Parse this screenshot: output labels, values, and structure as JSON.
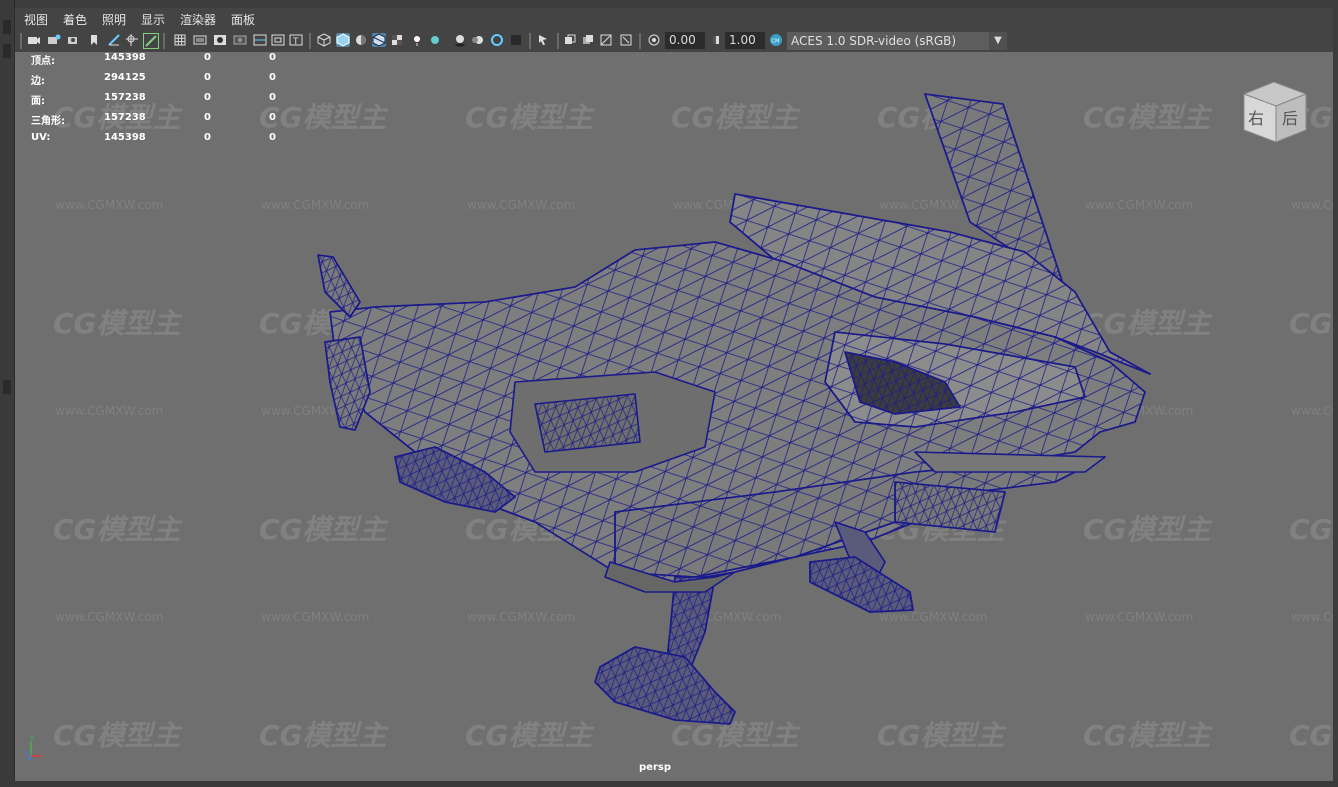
{
  "menu": {
    "items": [
      "视图",
      "着色",
      "照明",
      "显示",
      "渲染器",
      "面板"
    ]
  },
  "toolbar": {
    "gamma_value": "0.00",
    "exposure_value": "1.00",
    "color_space": "ACES 1.0 SDR-video (sRGB)"
  },
  "hud": {
    "rows": [
      {
        "label": "顶点:",
        "v1": "145398",
        "v2": "0",
        "v3": "0"
      },
      {
        "label": "边:",
        "v1": "294125",
        "v2": "0",
        "v3": "0"
      },
      {
        "label": "面:",
        "v1": "157238",
        "v2": "0",
        "v3": "0"
      },
      {
        "label": "三角形:",
        "v1": "157238",
        "v2": "0",
        "v3": "0"
      },
      {
        "label": "UV:",
        "v1": "145398",
        "v2": "0",
        "v3": "0"
      }
    ]
  },
  "viewcube": {
    "face1": "右",
    "face2": "后"
  },
  "camera_label": "persp",
  "axis": {
    "x": "x",
    "y": "y",
    "z": "z"
  },
  "watermark": {
    "logo": "CG模型主",
    "url": "www.CGMXW.com"
  },
  "colors": {
    "wireframe": "#1a1a8c",
    "viewport_bg": "#6f6f6f",
    "selected_icon": "#5285a6"
  }
}
